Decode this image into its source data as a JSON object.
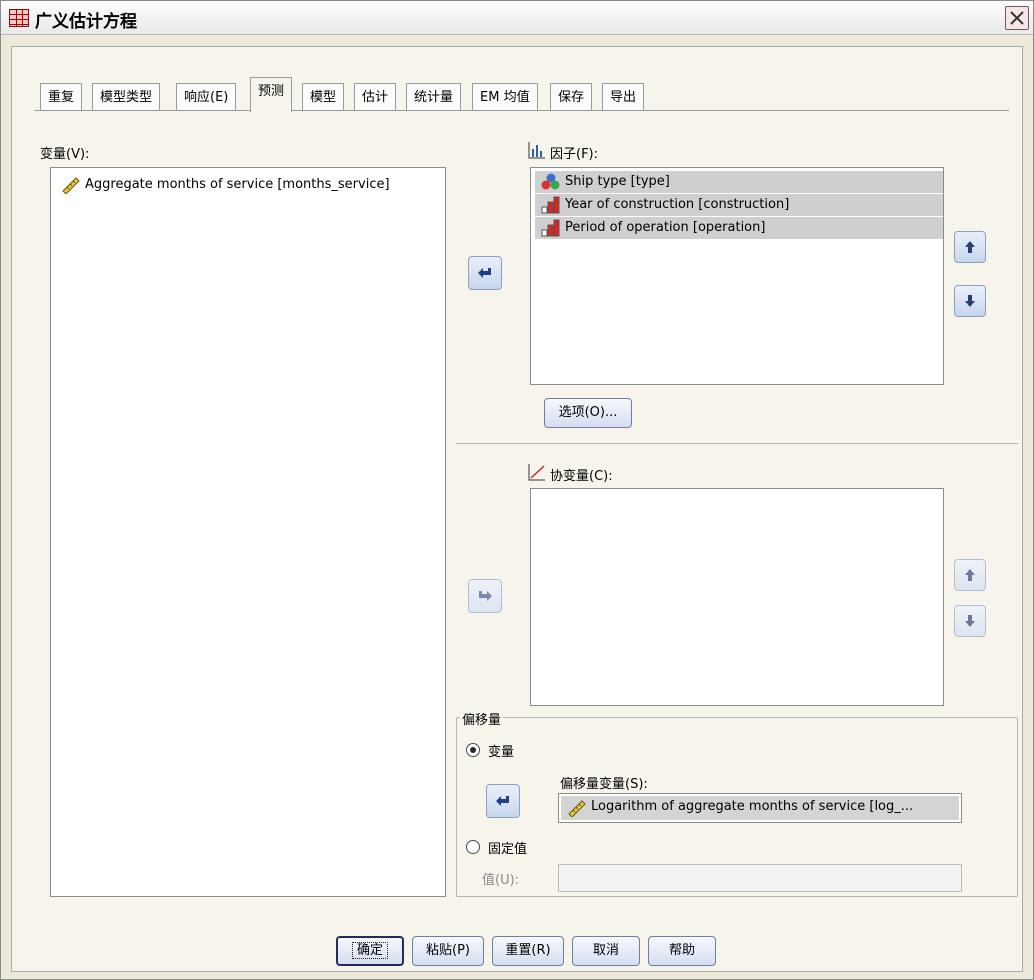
{
  "window": {
    "title": "广义估计方程",
    "close_icon": "close-icon"
  },
  "tabs": [
    {
      "label": "重复"
    },
    {
      "label": "模型类型"
    },
    {
      "label": "响应(E)"
    },
    {
      "label": "预测"
    },
    {
      "label": "模型"
    },
    {
      "label": "估计"
    },
    {
      "label": "统计量"
    },
    {
      "label": "EM 均值"
    },
    {
      "label": "保存"
    },
    {
      "label": "导出"
    }
  ],
  "active_tab": "预测",
  "variables": {
    "label": "变量(V):",
    "items": [
      {
        "text": "Aggregate months of service [months_service]",
        "icon": "scale-ruler-icon"
      }
    ]
  },
  "factors": {
    "label": "因子(F):",
    "icon": "factors-icon",
    "items": [
      {
        "text": "Ship type [type]",
        "icon": "nominal-icon"
      },
      {
        "text": "Year of construction [construction]",
        "icon": "ordinal-icon"
      },
      {
        "text": "Period of operation [operation]",
        "icon": "ordinal-icon"
      }
    ],
    "options_button": "选项(O)..."
  },
  "covariates": {
    "label": "协变量(C):",
    "icon": "covariates-icon",
    "items": []
  },
  "offset": {
    "group_label": "偏移量",
    "radio_variable": "变量",
    "radio_fixed": "固定值",
    "selected": "变量",
    "offset_var_label": "偏移量变量(S):",
    "offset_var_value": "Logarithm of aggregate months of service [log_...",
    "value_label": "值(U):",
    "value_text": ""
  },
  "buttons": {
    "ok": "确定",
    "paste": "粘贴(P)",
    "reset": "重置(R)",
    "cancel": "取消",
    "help": "帮助"
  }
}
